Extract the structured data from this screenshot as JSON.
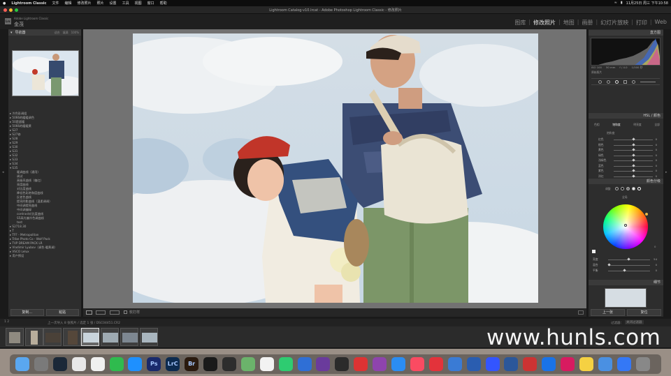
{
  "menubar": {
    "app": "Lightroom Classic",
    "items": [
      "文件",
      "编辑",
      "修改照片",
      "照片",
      "设置",
      "工具",
      "视图",
      "窗口",
      "帮助"
    ],
    "right_text": "11月25日 周三 下午10:58"
  },
  "window": {
    "title": "Lightroom Catalog-v10.lrcat - Adobe Photoshop Lightroom Classic - 修改照片"
  },
  "identity": {
    "logo": "Lrc",
    "sub": "Adobe Lightroom Classic",
    "name": "金茂"
  },
  "modules": {
    "items": [
      {
        "label": "图库",
        "active": false
      },
      {
        "label": "修改照片",
        "active": true
      },
      {
        "label": "地图",
        "active": false
      },
      {
        "label": "画册",
        "active": false
      },
      {
        "label": "幻灯片放映",
        "active": false
      },
      {
        "label": "打印",
        "active": false
      },
      {
        "label": "Web",
        "active": false
      }
    ]
  },
  "left": {
    "navigator": {
      "title": "导航器",
      "opts": [
        "适合",
        "填满",
        "100%"
      ]
    },
    "presets": [
      {
        "label": "▸ 冷色彩调组",
        "sub": false
      },
      {
        "label": "▸ 5066的暖暖调色",
        "sub": false
      },
      {
        "label": "▸ 50是超暖",
        "sub": false
      },
      {
        "label": "▸ 5066的暖暖黄",
        "sub": false
      },
      {
        "label": "▸ S27",
        "sub": false
      },
      {
        "label": "▸ S27修",
        "sub": false
      },
      {
        "label": "▸ S28",
        "sub": false
      },
      {
        "label": "▸ S29",
        "sub": false
      },
      {
        "label": "▸ S30",
        "sub": false
      },
      {
        "label": "▸ S31",
        "sub": false
      },
      {
        "label": "▸ S32",
        "sub": false
      },
      {
        "label": "▸ S33",
        "sub": false
      },
      {
        "label": "▸ S34",
        "sub": false
      },
      {
        "label": "▾ S35",
        "sub": false
      },
      {
        "label": "暖调曲线（通用）",
        "sub": true
      },
      {
        "label": "调试",
        "sub": true
      },
      {
        "label": "高级亮曲线（偏红）",
        "sub": true
      },
      {
        "label": "亮度曲线",
        "sub": true
      },
      {
        "label": "对比度曲线",
        "sub": true
      },
      {
        "label": "降低色彩饱和度曲线",
        "sub": true
      },
      {
        "label": "反差色曲线",
        "sub": true
      },
      {
        "label": "提亮阴影曲线（温柔调调）",
        "sub": true
      },
      {
        "label": "中间调提亮曲线",
        "sub": true
      },
      {
        "label": "中间调偏绿",
        "sub": true
      },
      {
        "label": "contrast对比度曲线",
        "sub": true
      },
      {
        "label": "S5高光偏冷色调曲线",
        "sub": true
      },
      {
        "label": "test",
        "sub": true
      },
      {
        "label": "▸ S2718.30",
        "sub": false
      },
      {
        "label": "▸ T",
        "sub": false
      },
      {
        "label": "▸ TFF - Metropolitan",
        "sub": false
      },
      {
        "label": "▸ Tribe Photo Co - Wolf Pack",
        "sub": false
      },
      {
        "label": "▸ TVP DREAM PACK LR",
        "sub": false
      },
      {
        "label": "▸ Vladimir Lyubov（调色·暖黄调）",
        "sub": false
      },
      {
        "label": "▸ VSCO Lelux",
        "sub": false
      },
      {
        "label": "",
        "sub": false
      },
      {
        "label": "▸ 用户预设",
        "sub": false
      }
    ],
    "copy_btn": "复制...",
    "paste_btn": "粘贴"
  },
  "toolbar": {
    "softproof": "软打样"
  },
  "right": {
    "histogram_title": "直方图",
    "histo_info": [
      "ISO 100",
      "50 mm",
      "f / 4.0",
      "1/500 秒"
    ],
    "orig_photo": "原始照片",
    "hsl_title": "HSL / 颜色",
    "hsl_tabs": [
      "色相",
      "饱和度",
      "明亮度",
      "全部"
    ],
    "saturation_title": "饱和度",
    "hsl_rows": [
      {
        "label": "红色",
        "value": "0"
      },
      {
        "label": "橙色",
        "value": "0"
      },
      {
        "label": "黄色",
        "value": "0"
      },
      {
        "label": "绿色",
        "value": "0"
      },
      {
        "label": "浅绿色",
        "value": "0"
      },
      {
        "label": "蓝色",
        "value": "0"
      },
      {
        "label": "紫色",
        "value": "0"
      },
      {
        "label": "洋红",
        "value": "0"
      }
    ],
    "colorgrade_title": "颜色分级",
    "adjust_label": "调整",
    "global_label": "全局",
    "grade_rows": [
      {
        "label": "亮度",
        "value": "54"
      },
      {
        "label": "混合",
        "value": "0"
      },
      {
        "label": "平衡",
        "value": "0"
      }
    ],
    "wheel_value": "0",
    "detail_title": "细节",
    "prev_btn": "上一张",
    "reset_btn": "复位"
  },
  "filmbar": {
    "left": "1  2",
    "text": "上一次导入  8 张照片 / 选定 1 张 / DSC04451.CR2",
    "filter": "过滤器：",
    "filter_val": "关闭过滤器"
  },
  "watermark": "www.hunls.com",
  "colors": {
    "accent_active": "#eaeaea",
    "panel_bg": "#2d2d2d",
    "image_bg": "#727272"
  },
  "dock_icons": [
    "Finder",
    "Launchpad",
    "Steam",
    "Chrome",
    "QQ",
    "微信",
    "Safari",
    "Ps",
    "LrC",
    "Br",
    "1Password",
    "Aperture",
    "Maps",
    "Photos",
    "FaceTime",
    "Lightroom",
    "Final Cut",
    "QuickTime",
    "Netease",
    "Podcasts",
    "App Store",
    "Music",
    "Weibo",
    "Cloud",
    "Transmit",
    "Lark",
    "Word",
    "Tools",
    "TestFlight",
    "Creative Cloud",
    "Notes",
    "Mail",
    "Files",
    "Trash"
  ]
}
